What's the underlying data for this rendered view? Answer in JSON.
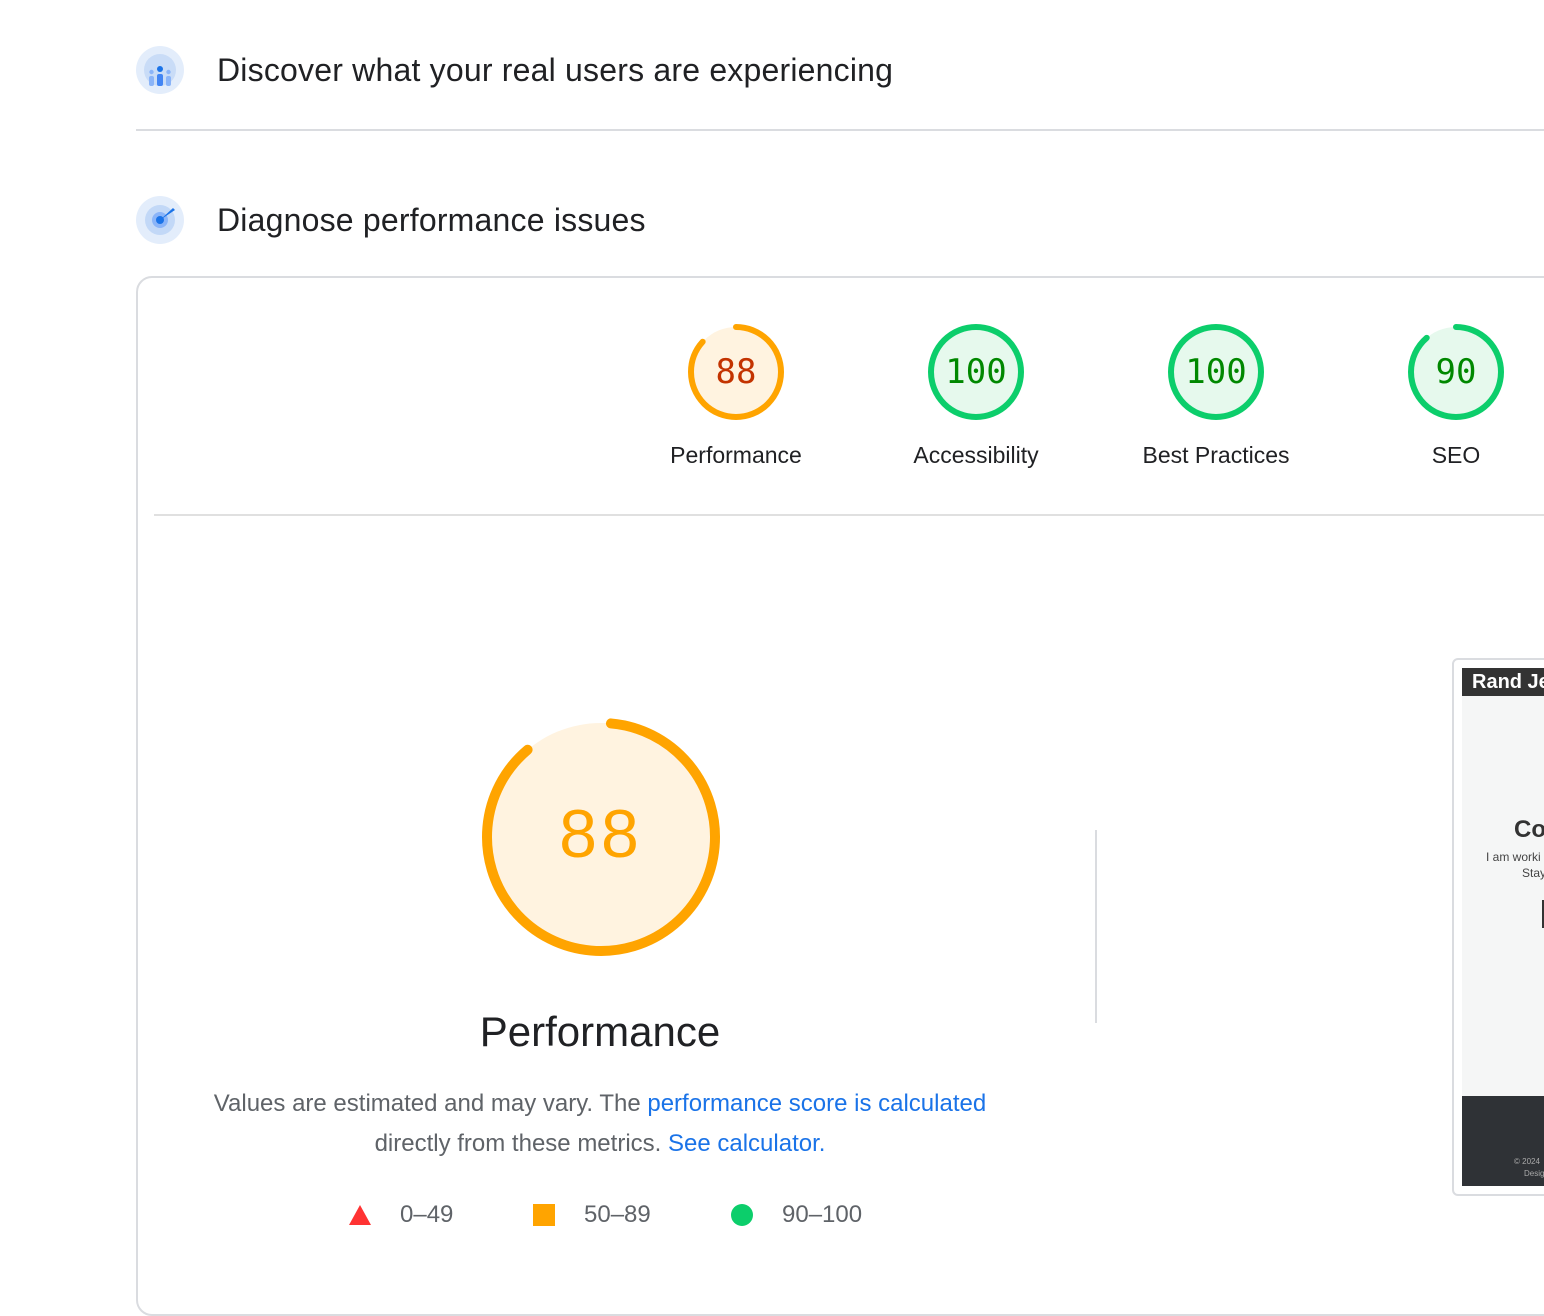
{
  "sections": {
    "discover_title": "Discover what your real users are experiencing",
    "diagnose_title": "Diagnose performance issues"
  },
  "scores": [
    {
      "label": "Performance",
      "value": "88",
      "score": 88,
      "rating": "average"
    },
    {
      "label": "Accessibility",
      "value": "100",
      "score": 100,
      "rating": "pass"
    },
    {
      "label": "Best Practices",
      "value": "100",
      "score": 100,
      "rating": "pass"
    },
    {
      "label": "SEO",
      "value": "90",
      "score": 90,
      "rating": "pass"
    }
  ],
  "performance": {
    "value": "88",
    "score": 88,
    "title": "Performance",
    "note_prefix": "Values are estimated and may vary. The",
    "note_link": "performance score is calculated",
    "note_middle": "directly from these metrics.",
    "calculator_link": "See calculator."
  },
  "legend": [
    {
      "shape": "triangle",
      "range": "0–49",
      "color": "#ff3333"
    },
    {
      "shape": "square",
      "range": "50–89",
      "color": "#ffa400"
    },
    {
      "shape": "circle",
      "range": "90–100",
      "color": "#0cce6b"
    }
  ],
  "screenshot": {
    "bar_title": "Rand Je",
    "heading": "Co",
    "text1": "I am worki",
    "text2": "Stay",
    "footer1": "© 2024",
    "footer2": "Desig"
  },
  "colors": {
    "average_ring": "#ffa400",
    "average_fill": "#fff3e0",
    "average_text_small": "#c33300",
    "average_text_large": "#ffa400",
    "pass_ring": "#0cce6b",
    "pass_fill": "#e6f9ed",
    "pass_text": "#008800",
    "link": "#1a73e8"
  },
  "icons": {
    "discover": "crux-users-icon",
    "diagnose": "lighthouse-target-icon"
  }
}
